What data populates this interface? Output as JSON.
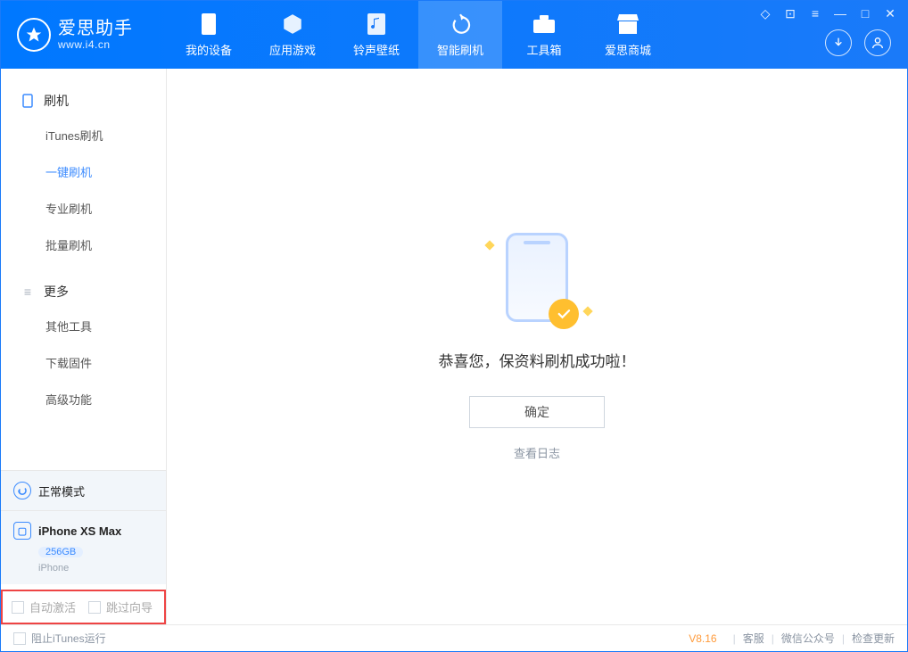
{
  "app": {
    "name": "爱思助手",
    "url": "www.i4.cn"
  },
  "nav": {
    "tabs": [
      {
        "label": "我的设备"
      },
      {
        "label": "应用游戏"
      },
      {
        "label": "铃声壁纸"
      },
      {
        "label": "智能刷机"
      },
      {
        "label": "工具箱"
      },
      {
        "label": "爱思商城"
      }
    ],
    "active_index": 3
  },
  "sidebar": {
    "sections": [
      {
        "title": "刷机",
        "icon": "phone",
        "items": [
          {
            "label": "iTunes刷机"
          },
          {
            "label": "一键刷机"
          },
          {
            "label": "专业刷机"
          },
          {
            "label": "批量刷机"
          }
        ],
        "active_index": 1
      },
      {
        "title": "更多",
        "icon": "menu",
        "items": [
          {
            "label": "其他工具"
          },
          {
            "label": "下载固件"
          },
          {
            "label": "高级功能"
          }
        ],
        "active_index": -1
      }
    ],
    "mode_label": "正常模式",
    "device": {
      "name": "iPhone XS Max",
      "capacity": "256GB",
      "type": "iPhone"
    },
    "checks": [
      {
        "label": "自动激活"
      },
      {
        "label": "跳过向导"
      }
    ]
  },
  "main": {
    "success_message": "恭喜您，保资料刷机成功啦！",
    "ok_button": "确定",
    "view_log": "查看日志"
  },
  "footer": {
    "block_itunes": "阻止iTunes运行",
    "version": "V8.16",
    "links": [
      "客服",
      "微信公众号",
      "检查更新"
    ]
  }
}
